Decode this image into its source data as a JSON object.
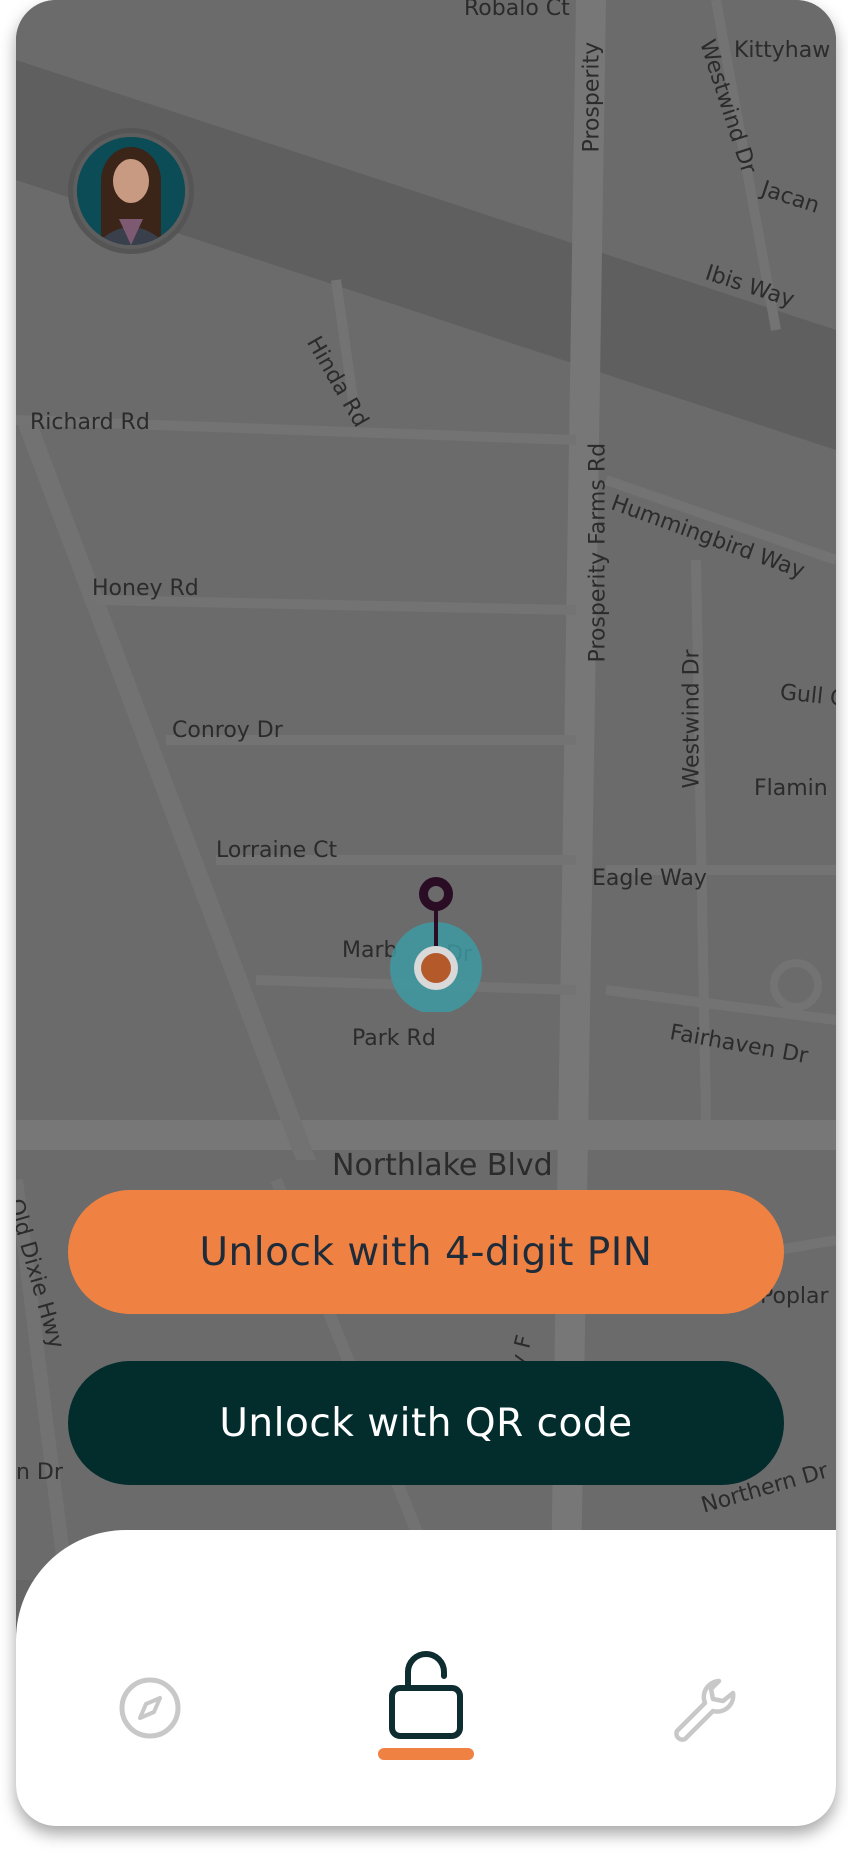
{
  "map": {
    "streets": [
      {
        "name": "Robalo Ct"
      },
      {
        "name": "Kittyhaw"
      },
      {
        "name": "Westwind Dr"
      },
      {
        "name": "Prosperity"
      },
      {
        "name": "Jacan"
      },
      {
        "name": "Ibis Way"
      },
      {
        "name": "Hinda Rd"
      },
      {
        "name": "Richard Rd"
      },
      {
        "name": "Prosperity Farms Rd"
      },
      {
        "name": "Hummingbird Way"
      },
      {
        "name": "Honey Rd"
      },
      {
        "name": "Westwind Dr"
      },
      {
        "name": "Gull C"
      },
      {
        "name": "Conroy Dr"
      },
      {
        "name": "Flamin"
      },
      {
        "name": "Lorraine Ct"
      },
      {
        "name": "Eagle Way"
      },
      {
        "name": "Marb"
      },
      {
        "name": "Dr"
      },
      {
        "name": "Park Rd"
      },
      {
        "name": "Fairhaven Dr"
      },
      {
        "name": "Northlake Blvd"
      },
      {
        "name": "Old Dixie Hwy"
      },
      {
        "name": "Poplar"
      },
      {
        "name": "n Dr"
      },
      {
        "name": "Northern Dr"
      },
      {
        "name": "rity F"
      }
    ]
  },
  "actions": {
    "pin_label": "Unlock with 4-digit PIN",
    "qr_label": "Unlock with QR code"
  },
  "nav": {
    "items": [
      {
        "icon": "compass-icon",
        "active": false
      },
      {
        "icon": "unlock-icon",
        "active": true
      },
      {
        "icon": "wrench-icon",
        "active": false
      }
    ]
  },
  "colors": {
    "accent": "#ef8242",
    "dark": "#032c2d",
    "map": "#6b6b6b",
    "location_ring": "#3e9aa2",
    "location_dot": "#b4592a",
    "pin": "#2a0c24"
  }
}
